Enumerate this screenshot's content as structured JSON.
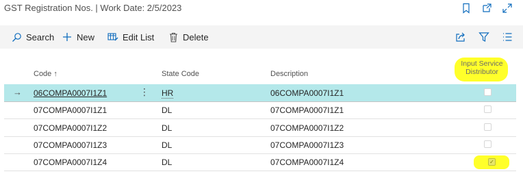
{
  "page": {
    "title": "GST Registration Nos. | Work Date: 2/5/2023"
  },
  "top_icons": [
    "bookmark-icon",
    "open-new-window-icon",
    "expand-icon"
  ],
  "actions": {
    "search": "Search",
    "new": "New",
    "edit_list": "Edit List",
    "delete": "Delete"
  },
  "right_actions": [
    "share-icon",
    "filter-icon",
    "list-view-icon"
  ],
  "columns": {
    "code": "Code ↑",
    "state_code": "State Code",
    "description": "Description",
    "input_service_distributor": "Input Service Distributor"
  },
  "rows": [
    {
      "code": "06COMPA0007I1Z1",
      "state_code": "HR",
      "description": "06COMPA0007I1Z1",
      "input_service_distributor": false,
      "selected": true
    },
    {
      "code": "07COMPA0007I1Z1",
      "state_code": "DL",
      "description": "07COMPA0007I1Z1",
      "input_service_distributor": false,
      "selected": false
    },
    {
      "code": "07COMPA0007I1Z2",
      "state_code": "DL",
      "description": "07COMPA0007I1Z2",
      "input_service_distributor": false,
      "selected": false
    },
    {
      "code": "07COMPA0007I1Z3",
      "state_code": "DL",
      "description": "07COMPA0007I1Z3",
      "input_service_distributor": false,
      "selected": false
    },
    {
      "code": "07COMPA0007I1Z4",
      "state_code": "DL",
      "description": "07COMPA0007I1Z4",
      "input_service_distributor": true,
      "selected": false
    }
  ],
  "colors": {
    "selected_row": "#b4e8ea",
    "highlight": "#ffff2a",
    "action_bar": "#f4f4f4"
  }
}
